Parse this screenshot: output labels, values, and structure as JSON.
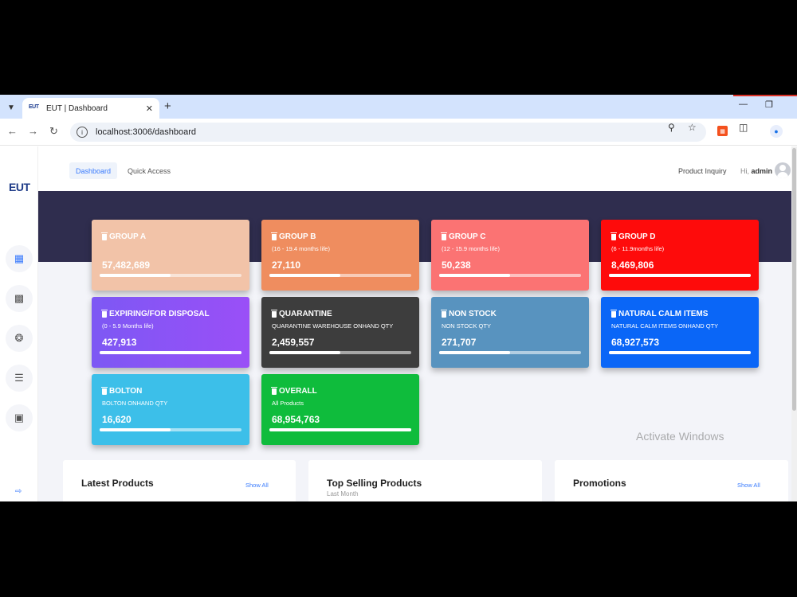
{
  "browser": {
    "tab_title": "EUT | Dashboard",
    "tab_favicon": "EUT",
    "new_tab": "+",
    "url": "localhost:3006/dashboard"
  },
  "sidebar": {
    "logo": "EUT"
  },
  "topnav": {
    "tabs": [
      "Dashboard",
      "Quick Access"
    ],
    "product_inquiry": "Product Inquiry",
    "greeting": "Hi,",
    "username": "admin"
  },
  "cards": [
    {
      "title": "GROUP A",
      "subtitle": "",
      "value": "57,482,689",
      "color": "#f2c3a8",
      "progress": 0.5
    },
    {
      "title": "GROUP B",
      "subtitle": "(16 - 19.4 months life)",
      "value": "27,110",
      "color": "#ef8d5f",
      "progress": 0.5
    },
    {
      "title": "GROUP C",
      "subtitle": "(12 - 15.9 months life)",
      "value": "50,238",
      "color": "#fb7373",
      "progress": 0.5
    },
    {
      "title": "GROUP D",
      "subtitle": "(6 - 11.9months life)",
      "value": "8,469,806",
      "color": "#fe0b0b",
      "progress": 1.0
    },
    {
      "title": "EXPIRING/FOR DISPOSAL",
      "subtitle": "(0 - 5.9 Months life)",
      "value": "427,913",
      "color": "#7d58f4",
      "progress": 1.0
    },
    {
      "title": "QUARANTINE",
      "subtitle": "QUARANTINE WAREHOUSE ONHAND QTY",
      "value": "2,459,557",
      "color": "#3d3d3d",
      "progress": 0.5
    },
    {
      "title": "NON STOCK",
      "subtitle": "NON STOCK QTY",
      "value": "271,707",
      "color": "#5893bf",
      "progress": 0.5
    },
    {
      "title": "NATURAL CALM ITEMS",
      "subtitle": "NATURAL CALM ITEMS ONHAND QTY",
      "value": "68,927,573",
      "color": "#0a66f7",
      "progress": 1.0
    },
    {
      "title": "BOLTON",
      "subtitle": "BOLTON ONHAND QTY",
      "value": "16,620",
      "color": "#3cbfe9",
      "progress": 0.5
    },
    {
      "title": "OVERALL",
      "subtitle": "All Products",
      "value": "68,954,763",
      "color": "#0fbc3c",
      "progress": 1.0
    }
  ],
  "panels": [
    {
      "title": "Latest Products",
      "subtitle": "",
      "link": "Show All"
    },
    {
      "title": "Top Selling Products",
      "subtitle": "Last Month",
      "link": ""
    },
    {
      "title": "Promotions",
      "subtitle": "",
      "link": "Show All"
    }
  ],
  "watermark": "Activate Windows"
}
